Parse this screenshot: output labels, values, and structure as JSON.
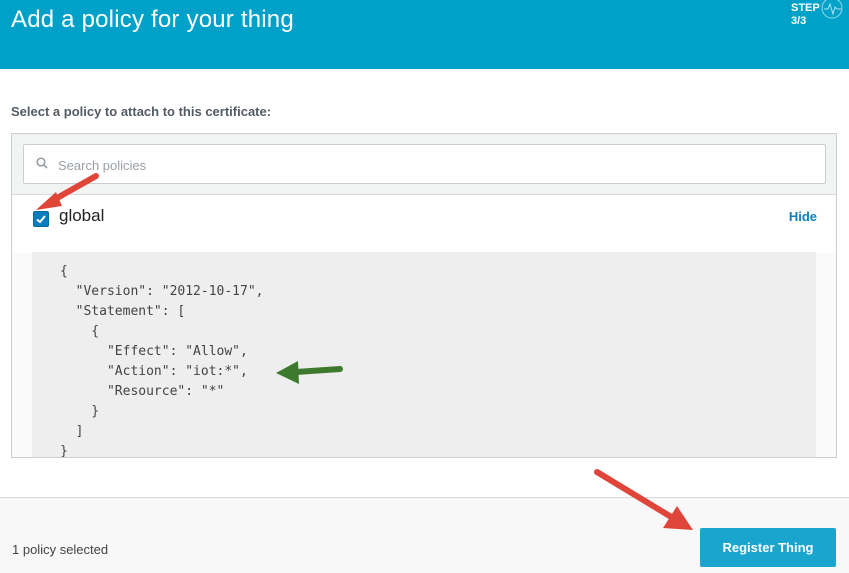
{
  "header": {
    "title": "Add a policy for your thing",
    "step_label": "STEP",
    "step_value": "3/3"
  },
  "prompt": "Select a policy to attach to this certificate:",
  "search": {
    "placeholder": "Search policies",
    "value": ""
  },
  "policy": {
    "name": "global",
    "checked": true,
    "hide_label": "Hide",
    "document": "{\n  \"Version\": \"2012-10-17\",\n  \"Statement\": [\n    {\n      \"Effect\": \"Allow\",\n      \"Action\": \"iot:*\",\n      \"Resource\": \"*\"\n    }\n  ]\n}"
  },
  "footer": {
    "selected_count": "1 policy selected",
    "register_label": "Register Thing"
  },
  "colors": {
    "header": "#00a1c9",
    "button": "#1aa5cf",
    "link": "#0a7dbd",
    "red_arrow": "#e0453a",
    "green_arrow": "#3e7a2e"
  }
}
